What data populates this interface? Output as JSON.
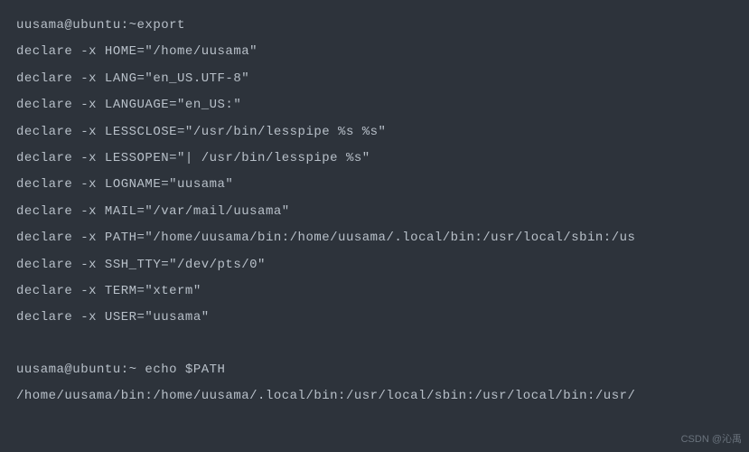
{
  "terminal": {
    "lines": [
      "uusama@ubuntu:~export",
      "declare -x HOME=\"/home/uusama\"",
      "declare -x LANG=\"en_US.UTF-8\"",
      "declare -x LANGUAGE=\"en_US:\"",
      "declare -x LESSCLOSE=\"/usr/bin/lesspipe %s %s\"",
      "declare -x LESSOPEN=\"| /usr/bin/lesspipe %s\"",
      "declare -x LOGNAME=\"uusama\"",
      "declare -x MAIL=\"/var/mail/uusama\"",
      "declare -x PATH=\"/home/uusama/bin:/home/uusama/.local/bin:/usr/local/sbin:/us",
      "declare -x SSH_TTY=\"/dev/pts/0\"",
      "declare -x TERM=\"xterm\"",
      "declare -x USER=\"uusama\"",
      "",
      "uusama@ubuntu:~ echo $PATH",
      "/home/uusama/bin:/home/uusama/.local/bin:/usr/local/sbin:/usr/local/bin:/usr/"
    ]
  },
  "watermark": "CSDN @沁禹"
}
